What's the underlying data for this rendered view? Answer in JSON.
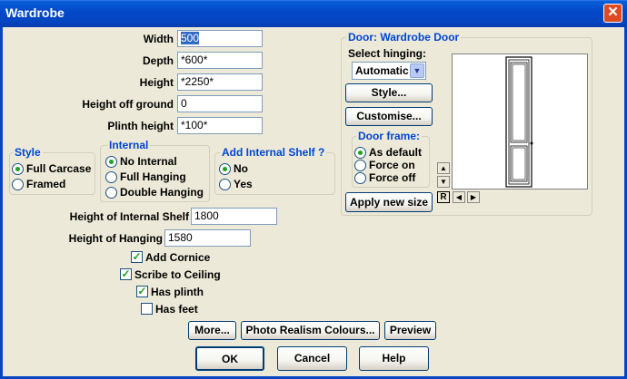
{
  "window": {
    "title": "Wardrobe",
    "close_glyph": "✕"
  },
  "fields": {
    "width": {
      "label": "Width",
      "value": "500"
    },
    "depth": {
      "label": "Depth",
      "value": "*600*"
    },
    "height": {
      "label": "Height",
      "value": "*2250*"
    },
    "height_off_ground": {
      "label": "Height off ground",
      "value": "0"
    },
    "plinth_height": {
      "label": "Plinth height",
      "value": "*100*"
    },
    "internal_shelf_height": {
      "label": "Height of Internal Shelf",
      "value": "1800"
    },
    "hanging_height": {
      "label": "Height of Hanging",
      "value": "1580"
    }
  },
  "style_group": {
    "label": "Style",
    "options": [
      "Full Carcase",
      "Framed"
    ],
    "selected": "Full Carcase"
  },
  "internal_group": {
    "label": "Internal",
    "options": [
      "No Internal",
      "Full Hanging",
      "Double Hanging"
    ],
    "selected": "No Internal"
  },
  "shelf_group": {
    "label": "Add Internal Shelf ?",
    "options": [
      "No",
      "Yes"
    ],
    "selected": "No"
  },
  "checkboxes": {
    "add_cornice": {
      "label": "Add Cornice",
      "checked": true
    },
    "scribe_to_ceiling": {
      "label": "Scribe to Ceiling",
      "checked": true
    },
    "has_plinth": {
      "label": "Has plinth",
      "checked": true
    },
    "has_feet": {
      "label": "Has feet",
      "checked": false
    }
  },
  "door_group": {
    "label": "Door: Wardrobe Door",
    "hinging_label": "Select hinging:",
    "hinging_value": "Automatic",
    "style_button": "Style...",
    "customise_button": "Customise...",
    "frame_label": "Door frame:",
    "frame_options": [
      "As default",
      "Force on",
      "Force off"
    ],
    "frame_selected": "As default",
    "apply_button": "Apply new size",
    "reset_glyph": "R"
  },
  "buttons": {
    "more": "More...",
    "photo": "Photo Realism Colours...",
    "preview": "Preview",
    "ok": "OK",
    "cancel": "Cancel",
    "help": "Help"
  },
  "colors": {
    "titlebar": "#0A5FD8",
    "group_label": "#0046D5",
    "radio_dot": "#21A121"
  }
}
